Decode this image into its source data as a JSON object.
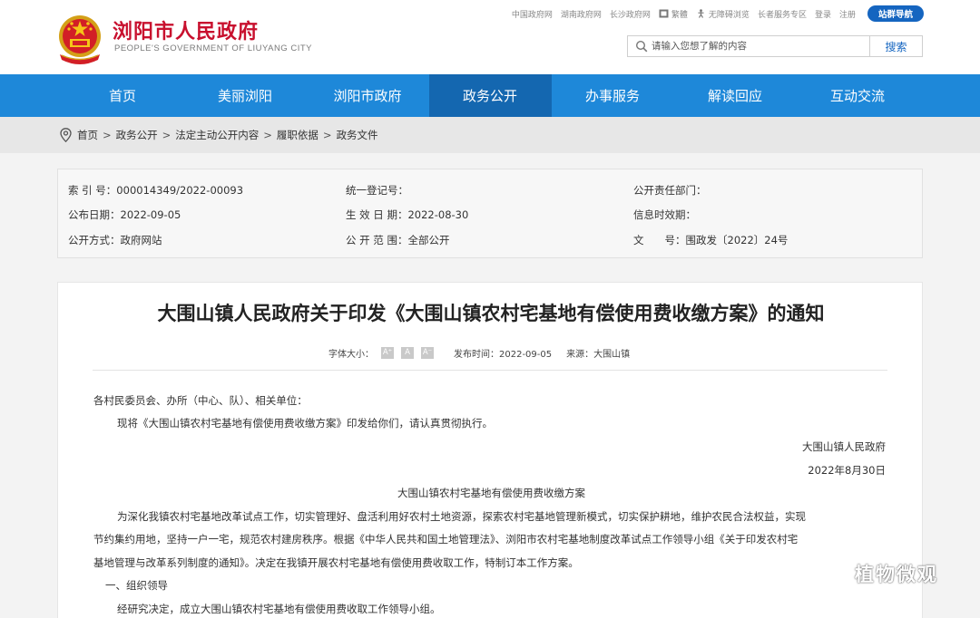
{
  "header": {
    "site_name": "浏阳市人民政府",
    "site_name_en": "PEOPLE'S GOVERNMENT OF LIUYANG CITY",
    "toplinks": [
      "中国政府网",
      "湖南政府网",
      "长沙政府网",
      "繁體",
      "无障碍浏览",
      "长者服务专区",
      "登录",
      "注册"
    ],
    "nav_guide": "站群导航",
    "search_placeholder": "请输入您想了解的内容",
    "search_button": "搜索"
  },
  "nav": {
    "items": [
      "首页",
      "美丽浏阳",
      "浏阳市政府",
      "政务公开",
      "办事服务",
      "解读回应",
      "互动交流"
    ],
    "active_index": 3
  },
  "breadcrumb": [
    "首页",
    "政务公开",
    "法定主动公开内容",
    "履职依据",
    "政务文件"
  ],
  "info": {
    "index_no": "索 引 号：000014349/2022-00093",
    "unified_reg": "统一登记号：",
    "dept": "公开责任部门：",
    "publish_date": "公布日期：2022-09-05",
    "effective_date": "生 效 日 期：2022-08-30",
    "validity": "信息时效期：",
    "method": "公开方式：政府网站",
    "scope": "公 开 范 围：全部公开",
    "doc_no": "文　　号：围政发〔2022〕24号"
  },
  "article": {
    "title": "大围山镇人民政府关于印发《大围山镇农村宅基地有偿使用费收缴方案》的通知",
    "font_size_label": "字体大小：",
    "font_buttons": [
      "A⁺",
      "A",
      "A⁻"
    ],
    "publish_time": "发布时间：2022-09-05",
    "source": "来源：大围山镇",
    "salutation": "各村民委员会、办所（中心、队）、相关单位：",
    "intro": "现将《大围山镇农村宅基地有偿使用费收缴方案》印发给你们，请认真贯彻执行。",
    "signature": "大围山镇人民政府",
    "date": "2022年8月30日",
    "sub_title": "大围山镇农村宅基地有偿使用费收缴方案",
    "para1_line1": "为深化我镇农村宅基地改革试点工作，切实管理好、盘活利用好农村土地资源，探索农村宅基地管理新模式，切实保护耕地，维护农民合法权益，实现",
    "para1_line2": "节约集约用地，坚持一户一宅，规范农村建房秩序。根据《中华人民共和国土地管理法》、浏阳市农村宅基地制度改革试点工作领导小组《关于印发农村宅",
    "para1_line3": "基地管理与改革系列制度的通知》。决定在我镇开展农村宅基地有偿使用费收取工作，特制订本工作方案。",
    "section1": "一、组织领导",
    "section1_text": "经研究决定，成立大围山镇农村宅基地有偿使用费收取工作领导小组。"
  },
  "watermark": "植物微观",
  "colors": {
    "brand_red": "#c8102e",
    "nav_blue": "#1e88d9",
    "nav_active": "#1467b0",
    "guide_btn": "#1565c0"
  }
}
